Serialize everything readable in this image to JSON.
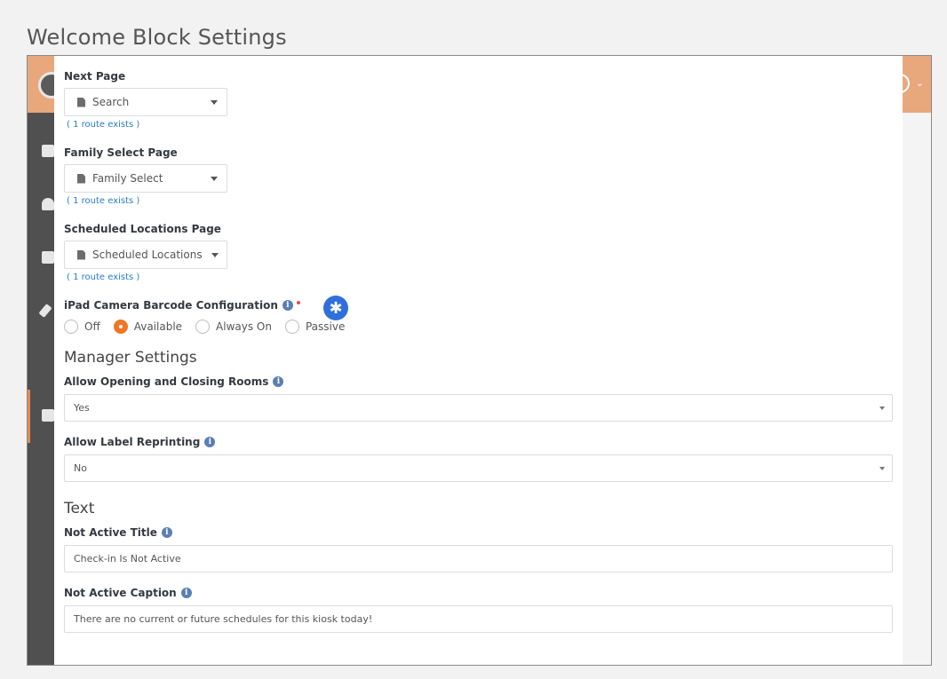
{
  "page": {
    "title": "Welcome Block Settings"
  },
  "fields": {
    "next_page": {
      "label": "Next Page",
      "value": "Search",
      "route": "( 1 route exists )"
    },
    "family_select_page": {
      "label": "Family Select Page",
      "value": "Family Select",
      "route": "( 1 route exists )"
    },
    "scheduled_locations_page": {
      "label": "Scheduled Locations Page",
      "value": "Scheduled Locations",
      "route": "( 1 route exists )"
    },
    "ipad_camera": {
      "label": "iPad Camera Barcode Configuration",
      "options": [
        "Off",
        "Available",
        "Always On",
        "Passive"
      ],
      "selected": "Available"
    }
  },
  "manager_settings": {
    "title": "Manager Settings",
    "allow_rooms": {
      "label": "Allow Opening and Closing Rooms",
      "value": "Yes"
    },
    "allow_reprint": {
      "label": "Allow Label Reprinting",
      "value": "No"
    }
  },
  "text_section": {
    "title": "Text",
    "not_active_title": {
      "label": "Not Active Title",
      "value": "Check-in Is Not Active"
    },
    "not_active_caption": {
      "label": "Not Active Caption",
      "value": "There are no current or future schedules for this kiosk today!"
    }
  },
  "icons": {
    "badge": "asterisk-icon",
    "info": "info-icon",
    "page": "document-icon"
  },
  "colors": {
    "accent": "#ee7624",
    "link": "#2a7cc7",
    "info": "#5b7fb4",
    "badge": "#2f6fdc",
    "required": "#d9534f"
  }
}
